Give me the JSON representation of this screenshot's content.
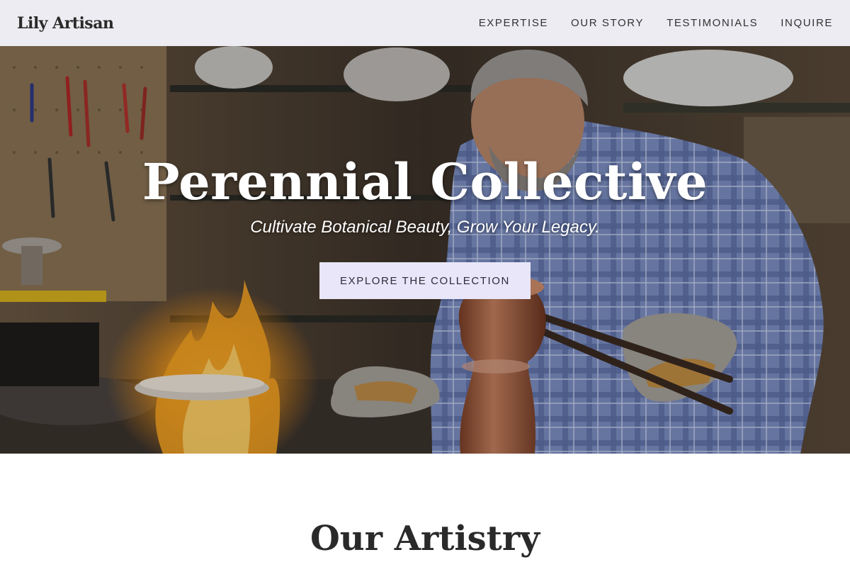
{
  "nav": {
    "brand": "Lily Artisan",
    "links": [
      "EXPERTISE",
      "OUR STORY",
      "TESTIMONIALS",
      "INQUIRE"
    ]
  },
  "hero": {
    "title": "Perennial Collective",
    "subtitle": "Cultivate Botanical Beauty, Grow Your Legacy.",
    "cta_label": "EXPLORE THE COLLECTION",
    "image_subject": "coppersmith-workshop-photo"
  },
  "section": {
    "title": "Our Artistry"
  },
  "colors": {
    "navbar_bg": "#ececf2",
    "cta_bg": "#e8e6f8",
    "text_dark": "#2a2a2a"
  }
}
